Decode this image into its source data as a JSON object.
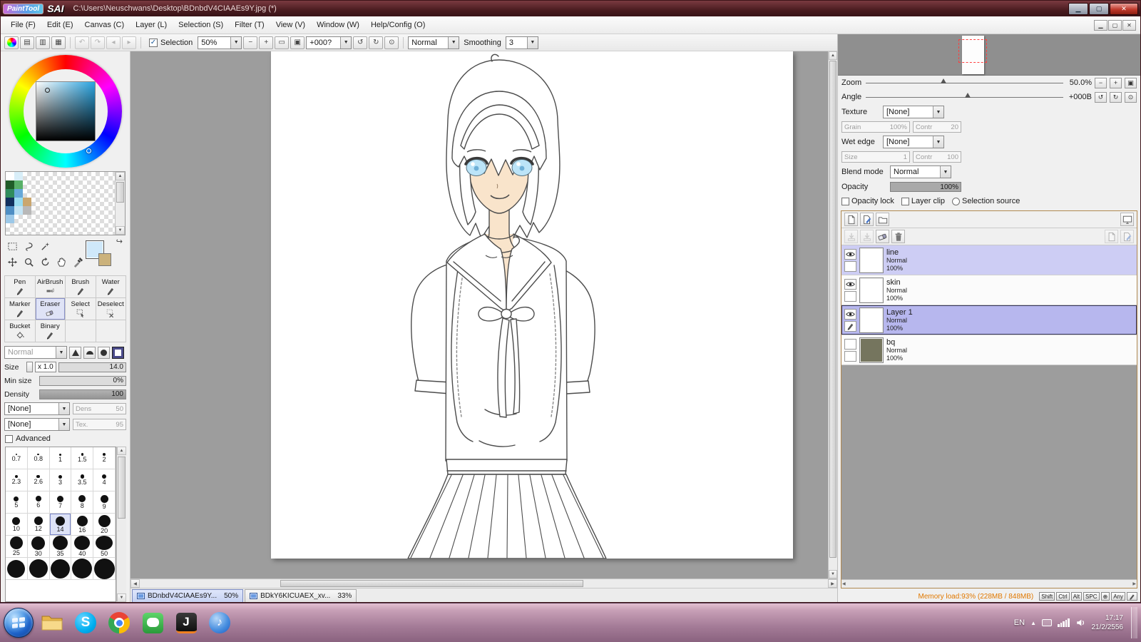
{
  "colors": {
    "titlebar_bg": "#4a1c20",
    "layer_selected": "#b7b7ee",
    "layer_highlight": "#cdcdf4",
    "memory_status_text": "#e07800",
    "eye_blue": "#bce4f8",
    "skin": "#f9e4cb",
    "canvas_surround": "#9d9d9d",
    "layerframe_border": "#b08850"
  },
  "titlebar": {
    "logo_paint": "PaintTool",
    "logo_sai": "SAI",
    "title": "C:\\Users\\Neuschwans\\Desktop\\BDnbdV4CIAAEs9Y.jpg (*)"
  },
  "menubar": {
    "items": [
      "File (F)",
      "Edit (E)",
      "Canvas (C)",
      "Layer (L)",
      "Selection (S)",
      "Filter (T)",
      "View (V)",
      "Window (W)",
      "Help/Config (O)"
    ]
  },
  "toolbar": {
    "selection_label": "Selection",
    "zoom_value": "50%",
    "angle_value": "+000?",
    "mode_button": "Normal",
    "smoothing_label": "Smoothing",
    "smoothing_value": "3"
  },
  "toolpanel": {
    "tools": [
      "Pen",
      "AirBrush",
      "Brush",
      "Water",
      "Marker",
      "Eraser",
      "Select",
      "Deselect",
      "Bucket",
      "Binary"
    ],
    "blend_value": "Normal",
    "size_label": "Size",
    "size_mult": "x 1.0",
    "size_value": "14.0",
    "minsize_label": "Min size",
    "minsize_value": "0%",
    "density_label": "Density",
    "density_value": "100",
    "slot1_value": "[None]",
    "slot1_key": "Dens",
    "slot1_num": "50",
    "slot2_value": "[None]",
    "slot2_key": "Tex.",
    "slot2_num": "95",
    "advanced_label": "Advanced",
    "sizes": [
      "0.7",
      "0.8",
      "1",
      "1.5",
      "2",
      "2.3",
      "2.6",
      "3",
      "3.5",
      "4",
      "5",
      "6",
      "7",
      "8",
      "9",
      "10",
      "12",
      "14",
      "16",
      "20",
      "25",
      "30",
      "35",
      "40",
      "50"
    ]
  },
  "navigator": {
    "zoom_label": "Zoom",
    "zoom_value": "50.0%",
    "angle_label": "Angle",
    "angle_value": "+000B"
  },
  "brushpanel": {
    "texture_label": "Texture",
    "texture_value": "[None]",
    "grain_label": "Grain",
    "grain_value": "100%",
    "grain_contr_label": "Contr",
    "grain_contr_value": "20",
    "wetedge_label": "Wet edge",
    "wetedge_value": "[None]",
    "wet_size_label": "Size",
    "wet_size_value": "1",
    "wet_contr_label": "Contr",
    "wet_contr_value": "100"
  },
  "layerpanel": {
    "blendmode_label": "Blend mode",
    "blendmode_value": "Normal",
    "opacity_label": "Opacity",
    "opacity_value": "100%",
    "opacity_lock_label": "Opacity lock",
    "layer_clip_label": "Layer clip",
    "selection_source_label": "Selection source",
    "layers": [
      {
        "name": "line",
        "mode": "Normal",
        "opacity": "100%"
      },
      {
        "name": "skin",
        "mode": "Normal",
        "opacity": "100%"
      },
      {
        "name": "Layer 1",
        "mode": "Normal",
        "opacity": "100%"
      },
      {
        "name": "bq",
        "mode": "Normal",
        "opacity": "100%"
      }
    ]
  },
  "statusbar": {
    "memory": "Memory load:93% (228MB / 848MB)",
    "keys": [
      "Shift",
      "Ctrl",
      "Alt",
      "SPC"
    ],
    "any_label": "Any"
  },
  "canvas": {
    "tabs": [
      {
        "label": "BDnbdV4CIAAEs9Y...",
        "zoom": "50%"
      },
      {
        "label": "BDkY6KICUAEX_xv...",
        "zoom": "33%"
      }
    ]
  },
  "taskbar": {
    "lang": "EN",
    "time": "17:17",
    "date": "21/2/2556"
  }
}
